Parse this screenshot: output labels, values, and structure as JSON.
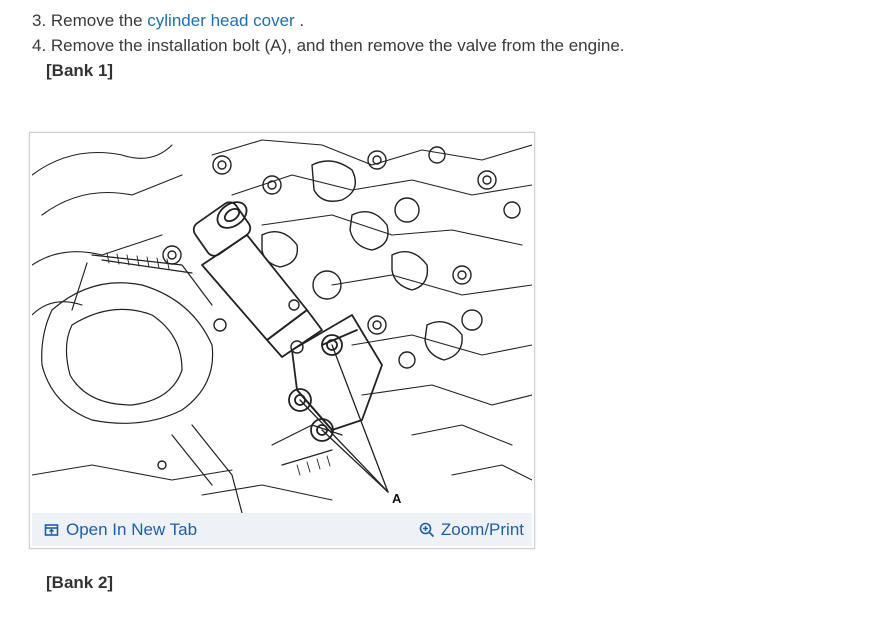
{
  "steps": [
    {
      "prefix": "3. Remove the ",
      "link": "cylinder head cover",
      "suffix": " ."
    },
    {
      "text": "4. Remove the installation bolt (A), and then remove the valve from the engine."
    }
  ],
  "sections": {
    "bank1": "[Bank 1]",
    "bank2": "[Bank 2]"
  },
  "figure": {
    "callout_label": "A",
    "open_tab_label": "Open In New Tab",
    "zoom_print_label": "Zoom/Print",
    "icons": {
      "open_tab": "open-new-tab-icon",
      "zoom": "zoom-in-icon"
    },
    "colors": {
      "link": "#1f6fb5",
      "bar_background": "#eef1f6",
      "bar_text": "#1f5fa8"
    }
  }
}
